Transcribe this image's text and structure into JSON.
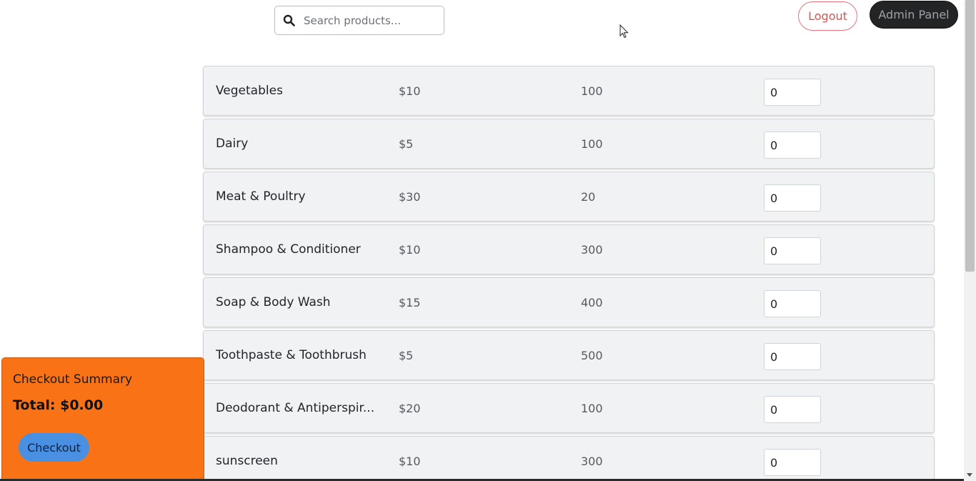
{
  "header": {
    "search_placeholder": "Search products...",
    "search_value": "",
    "logout_label": "Logout",
    "admin_label": "Admin Panel"
  },
  "products": [
    {
      "name": "Vegetables",
      "price": "$10",
      "stock": "100",
      "qty": "0"
    },
    {
      "name": "Dairy",
      "price": "$5",
      "stock": "100",
      "qty": "0"
    },
    {
      "name": "Meat & Poultry",
      "price": "$30",
      "stock": "20",
      "qty": "0"
    },
    {
      "name": "Shampoo & Conditioner",
      "price": "$10",
      "stock": "300",
      "qty": "0"
    },
    {
      "name": "Soap & Body Wash",
      "price": "$15",
      "stock": "400",
      "qty": "0"
    },
    {
      "name": "Toothpaste & Toothbrush",
      "price": "$5",
      "stock": "500",
      "qty": "0"
    },
    {
      "name": "Deodorant & Antiperspir...",
      "price": "$20",
      "stock": "100",
      "qty": "0"
    },
    {
      "name": "sunscreen",
      "price": "$10",
      "stock": "300",
      "qty": "0"
    }
  ],
  "checkout": {
    "title": "Checkout Summary",
    "total": "Total: $0.00",
    "button_label": "Checkout"
  },
  "colors": {
    "checkout_bg": "#f97316",
    "checkout_button": "#4a90e2",
    "logout_border": "#e3727c",
    "admin_bg": "#222426"
  },
  "icons": {
    "search": "search-icon",
    "cursor": "mouse-pointer-icon"
  }
}
